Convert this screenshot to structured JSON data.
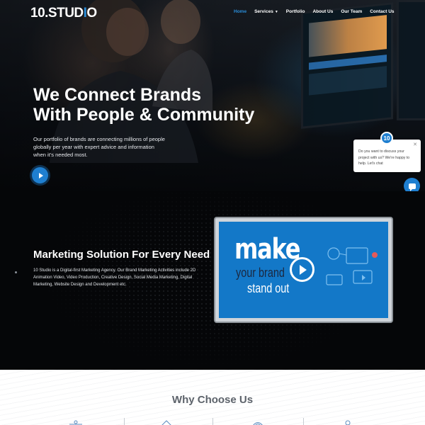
{
  "brand": {
    "logo_text": "10.STUD",
    "logo_bar": "I",
    "logo_end": "O",
    "accent_color": "#2a8fdc"
  },
  "nav": {
    "items": [
      {
        "label": "Home",
        "active": true
      },
      {
        "label": "Services",
        "has_dropdown": true
      },
      {
        "label": "Portfolio"
      },
      {
        "label": "About Us"
      },
      {
        "label": "Our Team"
      },
      {
        "label": "Contact Us"
      }
    ]
  },
  "hero": {
    "title_line1": "We Connect Brands",
    "title_line2": "With People & Community",
    "description": "Our portfolio of brands are connecting millions of people globally per year with expert advice and  information when it’s needed most."
  },
  "chat": {
    "avatar_text": "10",
    "message": "Do you want to discuss your project with us? We're happy to help. Let's chat",
    "close_icon": "close-icon",
    "fab_icon": "chat-icon"
  },
  "marketing": {
    "title": "Marketing Solution For Every Need",
    "description": "10 Studio is a Digital-first Marketing Agency. Our Brand Marketing Activities include 2D Animation Video, Video Production, Creative Design, Social Media Marketing, Digital Marketing, Website Design and Development etc.",
    "video": {
      "line1": "make",
      "line2": "your brand",
      "line3": "stand out"
    }
  },
  "why": {
    "title": "Why Choose Us"
  }
}
